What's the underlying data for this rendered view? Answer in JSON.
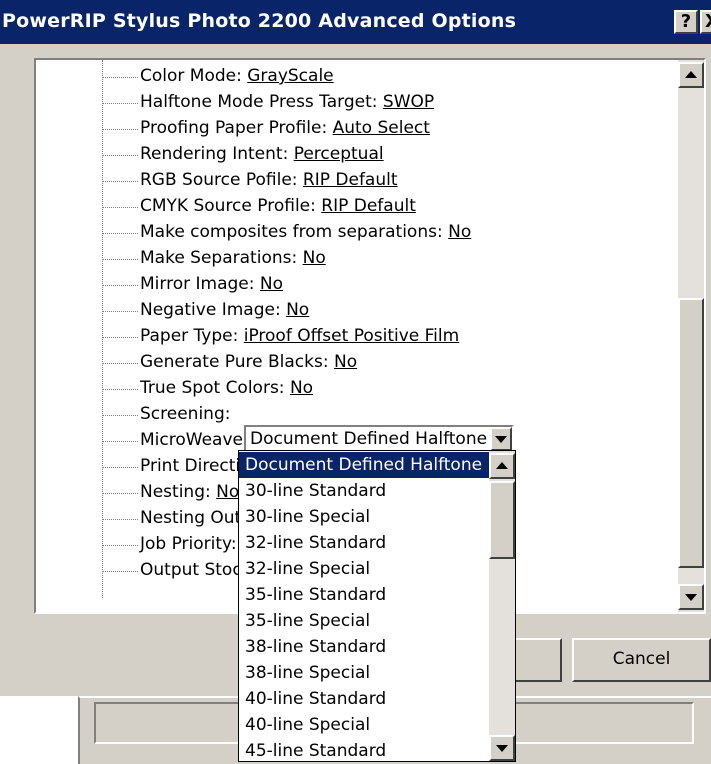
{
  "window": {
    "title": "PowerRIP Stylus Photo 2200 Advanced Options",
    "help_glyph": "?",
    "close_glyph": "X"
  },
  "tree": {
    "items": [
      {
        "label": "Color Mode: ",
        "value": "GrayScale"
      },
      {
        "label": "Halftone Mode Press Target: ",
        "value": "SWOP"
      },
      {
        "label": "Proofing Paper Profile: ",
        "value": "Auto Select"
      },
      {
        "label": "Rendering Intent: ",
        "value": "Perceptual"
      },
      {
        "label": "RGB Source Pofile: ",
        "value": "RIP Default"
      },
      {
        "label": "CMYK Source Profile: ",
        "value": "RIP Default"
      },
      {
        "label": "Make composites from separations: ",
        "value": "No"
      },
      {
        "label": "Make Separations: ",
        "value": "No"
      },
      {
        "label": "Mirror Image: ",
        "value": "No"
      },
      {
        "label": "Negative Image: ",
        "value": "No"
      },
      {
        "label": "Paper Type: ",
        "value": "iProof Offset Positive Film"
      },
      {
        "label": "Generate Pure Blacks: ",
        "value": "No"
      },
      {
        "label": "True Spot Colors: ",
        "value": "No"
      },
      {
        "label": "Screening: ",
        "value": ""
      },
      {
        "label": "MicroWeave",
        "value": ""
      },
      {
        "label": "Print Directic",
        "value": ""
      },
      {
        "label": "Nesting: ",
        "value": "No"
      },
      {
        "label": "Nesting Out",
        "value": ""
      },
      {
        "label": "Job Priority:",
        "value": ""
      },
      {
        "label": "Output Stoc",
        "value": ""
      }
    ],
    "screening_selected": "Document Defined Halftone"
  },
  "buttons": {
    "ok_label": "",
    "cancel_label": "Cancel"
  },
  "screening_dropdown": {
    "options": [
      "Document Defined Halftone",
      "30-line Standard",
      "30-line Special",
      "32-line Standard",
      "32-line Special",
      "35-line Standard",
      "35-line Special",
      "38-line Standard",
      "38-line Special",
      "40-line Standard",
      "40-line Special",
      "45-line Standard"
    ],
    "selected_index": 0
  },
  "colors": {
    "titlebar": "#0a246a",
    "face": "#d4d0c8",
    "selection": "#0a246a"
  },
  "icons": {
    "scroll_up": "triangle-up",
    "scroll_down": "triangle-down",
    "dropdown": "triangle-down"
  }
}
